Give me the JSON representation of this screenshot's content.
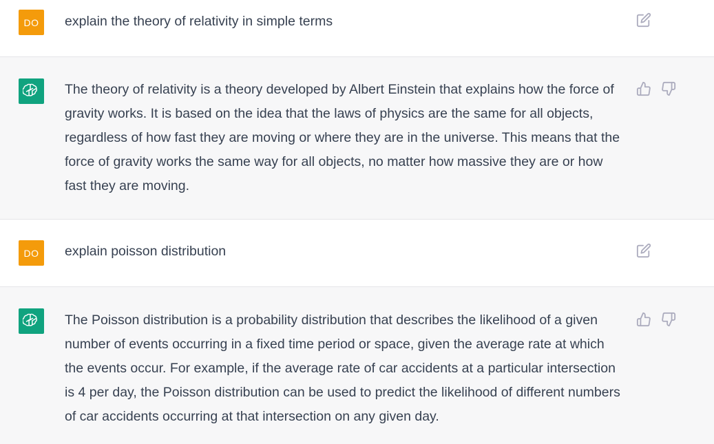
{
  "messages": [
    {
      "role": "user",
      "avatar_initials": "DO",
      "text": "explain the theory of relativity in simple terms"
    },
    {
      "role": "assistant",
      "text": "The theory of relativity is a theory developed by Albert Einstein that explains how the force of gravity works. It is based on the idea that the laws of physics are the same for all objects, regardless of how fast they are moving or where they are in the universe. This means that the force of gravity works the same way for all objects, no matter how massive they are or how fast they are moving."
    },
    {
      "role": "user",
      "avatar_initials": "DO",
      "text": "explain poisson distribution"
    },
    {
      "role": "assistant",
      "text": "The Poisson distribution is a probability distribution that describes the likelihood of a given number of events occurring in a fixed time period or space, given the average rate at which the events occur. For example, if the average rate of car accidents at a particular intersection is 4 per day, the Poisson distribution can be used to predict the likelihood of different numbers of car accidents occurring at that intersection on any given day."
    }
  ],
  "icons": {
    "edit": "edit-icon",
    "thumbs_up": "thumbs-up-icon",
    "thumbs_down": "thumbs-down-icon",
    "bot_logo": "openai-logo-icon"
  },
  "colors": {
    "user_avatar": "#f49b0b",
    "bot_avatar": "#10a37f",
    "assistant_bg": "#f7f7f8",
    "text": "#374151",
    "icon": "#acacbe"
  }
}
